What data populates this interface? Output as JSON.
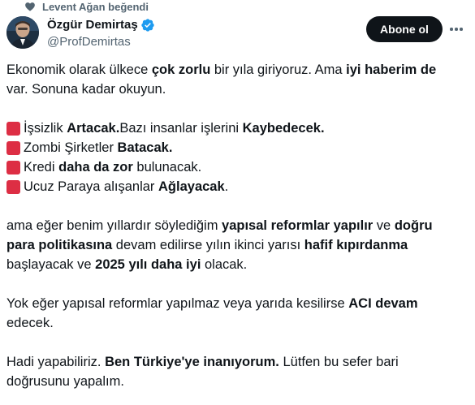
{
  "social_context": {
    "text": "Levent Ağan beğendi"
  },
  "author": {
    "name": "Özgür Demirtaş",
    "handle": "@ProfDemirtas"
  },
  "actions": {
    "follow_label": "Abone ol"
  },
  "colors": {
    "accent": "#0f1419",
    "verified": "#1d9bf0",
    "bullet": "#dd2e44",
    "muted": "#536471"
  },
  "icons": {
    "social": "heart-icon",
    "verified": "verified-badge-icon",
    "more": "more-icon",
    "bullet": "red-square-icon"
  },
  "tweet": {
    "p1": {
      "a": "Ekonomik olarak ülkece ",
      "b": "çok zorlu",
      "c": " bir yıla giriyoruz. Ama ",
      "d": "iyi haberim de",
      "e_line1": "",
      "e": " var. Sonuna kadar okuyun."
    },
    "list": [
      {
        "pre": "İşsizlik ",
        "b1": "Artacak.",
        "mid": " Bazı insanlar işlerini ",
        "b2": "Kaybedecek.",
        "post": ""
      },
      {
        "pre": "Zombi Şirketler ",
        "b1": "Batacak.",
        "mid": "",
        "b2": "",
        "post": ""
      },
      {
        "pre": "Kredi ",
        "b1": "daha da zor",
        "mid": " bulunacak.",
        "b2": "",
        "post": ""
      },
      {
        "pre": "Ucuz Paraya alışanlar ",
        "b1": "Ağlayacak",
        "mid": ".",
        "b2": "",
        "post": ""
      }
    ],
    "p3": {
      "a": "ama eğer benim yıllardır söylediğim ",
      "b": "yapısal reformlar yapılır",
      "c": " ve ",
      "d": "doğru para politikasına",
      "e": " devam edilirse yılın ikinci yarısı ",
      "f": "hafif kıpırdanma",
      "g": " başlayacak ve ",
      "h": "2025 yılı daha iyi",
      "i": " olacak."
    },
    "p4": {
      "a": "Yok eğer yapısal reformlar yapılmaz veya yarıda kesilirse ",
      "b": "ACI devam",
      "c": " edecek."
    },
    "p5": {
      "a": "Hadi yapabiliriz. ",
      "b": "Ben Türkiye'ye inanıyorum.",
      "c": " Lütfen bu sefer bari doğrusunu yapalım."
    }
  }
}
